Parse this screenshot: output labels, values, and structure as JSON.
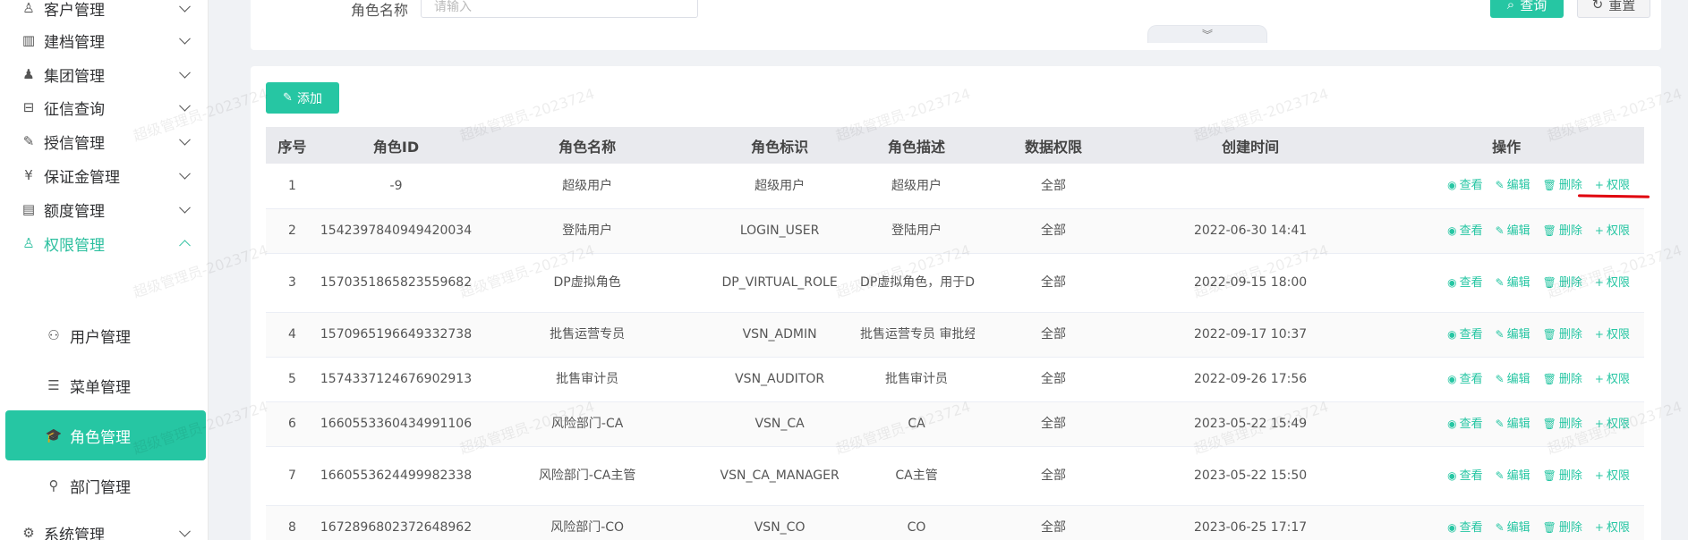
{
  "sidebar": {
    "items": [
      {
        "label": "客户管理",
        "icon": "customer-icon",
        "glyph": "♙"
      },
      {
        "label": "建档管理",
        "icon": "archive-icon",
        "glyph": "▥"
      },
      {
        "label": "集团管理",
        "icon": "group-icon",
        "glyph": "♟"
      },
      {
        "label": "征信查询",
        "icon": "credit-query-icon",
        "glyph": "⊟"
      },
      {
        "label": "授信管理",
        "icon": "credit-grant-icon",
        "glyph": "✎"
      },
      {
        "label": "保证金管理",
        "icon": "deposit-icon",
        "glyph": "¥"
      },
      {
        "label": "额度管理",
        "icon": "quota-icon",
        "glyph": "▤"
      },
      {
        "label": "权限管理",
        "icon": "permission-icon",
        "glyph": "♙"
      }
    ],
    "sub_items": [
      {
        "label": "用户管理",
        "icon": "user-icon",
        "glyph": "⚇"
      },
      {
        "label": "菜单管理",
        "icon": "menu-list-icon",
        "glyph": "☰"
      },
      {
        "label": "角色管理",
        "icon": "role-icon",
        "glyph": "🎓"
      },
      {
        "label": "部门管理",
        "icon": "department-icon",
        "glyph": "⚲"
      }
    ],
    "bottom_item": {
      "label": "系统管理",
      "icon": "settings-icon",
      "glyph": "⚙"
    }
  },
  "search": {
    "role_name_label": "角色名称",
    "role_name_placeholder": "请输入",
    "query_label": "查询",
    "query_glyph": "⌕",
    "reset_label": "重置",
    "reset_glyph": "↻",
    "collapse_glyph": "︾"
  },
  "toolbar": {
    "add_label": "添加",
    "add_glyph": "✎"
  },
  "table": {
    "columns": [
      "序号",
      "角色ID",
      "角色名称",
      "角色标识",
      "角色描述",
      "数据权限",
      "创建时间",
      "操作"
    ],
    "rows": [
      {
        "no": "1",
        "id": "-9",
        "name": "超级用户",
        "key": "超级用户",
        "desc": "超级用户",
        "scope": "全部",
        "created": ""
      },
      {
        "no": "2",
        "id": "1542397840949420034",
        "name": "登陆用户",
        "key": "LOGIN_USER",
        "desc": "登陆用户",
        "scope": "全部",
        "created": "2022-06-30 14:41"
      },
      {
        "no": "3",
        "id": "1570351865823559682",
        "name": "DP虚拟角色",
        "key": "DP_VIRTUAL_ROLE",
        "desc": "DP虚拟角色，用于DP...",
        "scope": "全部",
        "created": "2022-09-15 18:00"
      },
      {
        "no": "4",
        "id": "1570965196649332738",
        "name": "批售运营专员",
        "key": "VSN_ADMIN",
        "desc": "批售运营专员 审批经...",
        "scope": "全部",
        "created": "2022-09-17 10:37"
      },
      {
        "no": "5",
        "id": "1574337124676902913",
        "name": "批售审计员",
        "key": "VSN_AUDITOR",
        "desc": "批售审计员",
        "scope": "全部",
        "created": "2022-09-26 17:56"
      },
      {
        "no": "6",
        "id": "1660553360434991106",
        "name": "风险部门-CA",
        "key": "VSN_CA",
        "desc": "CA",
        "scope": "全部",
        "created": "2023-05-22 15:49"
      },
      {
        "no": "7",
        "id": "1660553624499982338",
        "name": "风险部门-CA主管",
        "key": "VSN_CA_MANAGER",
        "desc": "CA主管",
        "scope": "全部",
        "created": "2023-05-22 15:50"
      },
      {
        "no": "8",
        "id": "1672896802372648962",
        "name": "风险部门-CO",
        "key": "VSN_CO",
        "desc": "CO",
        "scope": "全部",
        "created": "2023-06-25 17:17"
      }
    ],
    "actions": [
      {
        "label": "查看",
        "icon": "eye-icon",
        "glyph": "◉"
      },
      {
        "label": "编辑",
        "icon": "edit-icon",
        "glyph": "✎"
      },
      {
        "label": "删除",
        "icon": "trash-icon",
        "glyph": "🗑"
      },
      {
        "label": "权限",
        "icon": "plus-icon",
        "glyph": "+"
      }
    ]
  },
  "watermark": "超级管理员-2023724",
  "colors": {
    "accent": "#26c6a3",
    "annotation": "#e0000d"
  }
}
